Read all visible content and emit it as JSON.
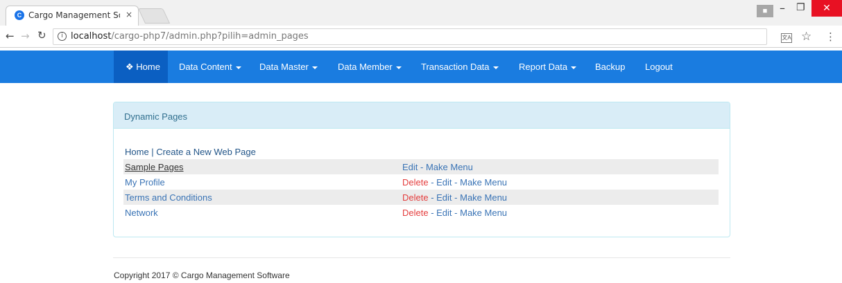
{
  "browser": {
    "tab_title": "Cargo Management Soft",
    "tab_close": "×",
    "url_host": "localhost",
    "url_path": "/cargo-php7/admin.php?pilih=admin_pages"
  },
  "navbar": {
    "items": [
      {
        "label": "Home",
        "icon": "home-icon",
        "active": true
      },
      {
        "label": "Data Content",
        "dropdown": true
      },
      {
        "label": "Data Master",
        "dropdown": true
      },
      {
        "label": "Data Member",
        "dropdown": true
      },
      {
        "label": "Transaction Data",
        "dropdown": true
      },
      {
        "label": "Report Data",
        "dropdown": true
      },
      {
        "label": "Backup"
      },
      {
        "label": "Logout"
      }
    ],
    "color": "#1a7ce0",
    "active_color": "#0b5fc2"
  },
  "panel": {
    "title": "Dynamic Pages",
    "crumb_home": "Home",
    "crumb_sep": " | ",
    "crumb_create": "Create a New Web Page",
    "rows": [
      {
        "title": "Sample Pages",
        "delete": "",
        "edit": "Edit",
        "make_menu": "Make Menu"
      },
      {
        "title": "My Profile",
        "delete": "Delete",
        "edit": "Edit",
        "make_menu": "Make Menu"
      },
      {
        "title": "Terms and Conditions",
        "delete": "Delete",
        "edit": "Edit",
        "make_menu": "Make Menu"
      },
      {
        "title": "Network",
        "delete": "Delete",
        "edit": "Edit",
        "make_menu": "Make Menu"
      }
    ],
    "separator": " - "
  },
  "footer": {
    "text": "Copyright 2017 © Cargo Management Software"
  }
}
